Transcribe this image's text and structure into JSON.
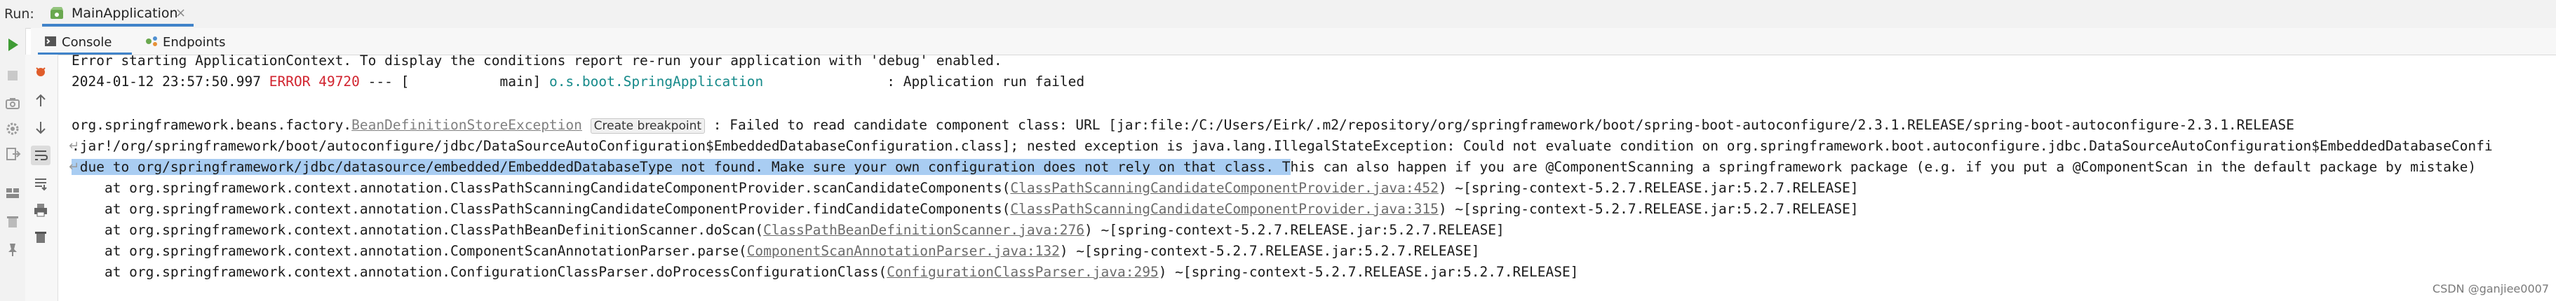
{
  "run": {
    "label": "Run:",
    "tab_title": "MainApplication",
    "close_glyph": "×"
  },
  "subtabs": {
    "console": "Console",
    "endpoints": "Endpoints"
  },
  "toolbar_icons": [
    "rerun-icon",
    "stop-icon",
    "camera-icon",
    "settings-icon",
    "exit-icon",
    "layout-icon",
    "pin-icon",
    "debug-icon",
    "up-arrow-icon",
    "down-arrow-icon",
    "soft-wrap-icon",
    "scroll-to-end-icon",
    "print-icon",
    "trash-icon"
  ],
  "console": {
    "line1": "Error starting ApplicationContext. To display the conditions report re-run your application with 'debug' enabled.",
    "line2": {
      "timestamp": "2024-01-12 23:57:50.997 ",
      "level": "ERROR",
      "pid": " 49720",
      "thread": " --- [           main] ",
      "logger": "o.s.boot.SpringApplication",
      "message": "               : Application run failed"
    },
    "line4": {
      "prefix": "org.springframework.beans.factory.",
      "exception_link": "BeanDefinitionStoreException",
      "breakpoint_button": "Create breakpoint",
      "rest": " : Failed to read candidate component class: URL [jar:file:/C:/Users/Eirk/.m2/repository/org/springframework/boot/spring-boot-autoconfigure/2.3.1.RELEASE/spring-boot-autoconfigure-2.3.1.RELEASE"
    },
    "line5": ".jar!/org/springframework/boot/autoconfigure/jdbc/DataSourceAutoConfiguration$EmbeddedDatabaseConfiguration.class]; nested exception is java.lang.IllegalStateException: Could not evaluate condition on org.springframework.boot.autoconfigure.jdbc.DataSourceAutoConfiguration$EmbeddedDatabaseConfi",
    "line6": {
      "highlighted": " due to org/springframework/jdbc/datasource/embedded/EmbeddedDatabaseType not found. Make sure your own configuration does not rely on that class. T",
      "rest": "his can also happen if you are @ComponentScanning a springframework package (e.g. if you put a @ComponentScan in the default package by mistake)"
    },
    "frames": [
      {
        "at": "    at org.springframework.context.annotation.ClassPathScanningCandidateComponentProvider.scanCandidateComponents(",
        "link": "ClassPathScanningCandidateComponentProvider.java:452",
        "tail": ") ~[spring-context-5.2.7.RELEASE.jar:5.2.7.RELEASE]"
      },
      {
        "at": "    at org.springframework.context.annotation.ClassPathScanningCandidateComponentProvider.findCandidateComponents(",
        "link": "ClassPathScanningCandidateComponentProvider.java:315",
        "tail": ") ~[spring-context-5.2.7.RELEASE.jar:5.2.7.RELEASE]"
      },
      {
        "at": "    at org.springframework.context.annotation.ClassPathBeanDefinitionScanner.doScan(",
        "link": "ClassPathBeanDefinitionScanner.java:276",
        "tail": ") ~[spring-context-5.2.7.RELEASE.jar:5.2.7.RELEASE]"
      },
      {
        "at": "    at org.springframework.context.annotation.ComponentScanAnnotationParser.parse(",
        "link": "ComponentScanAnnotationParser.java:132",
        "tail": ") ~[spring-context-5.2.7.RELEASE.jar:5.2.7.RELEASE]"
      },
      {
        "at": "    at org.springframework.context.annotation.ConfigurationClassParser.doProcessConfigurationClass(",
        "link": "ConfigurationClassParser.java:295",
        "tail": ") ~[spring-context-5.2.7.RELEASE.jar:5.2.7.RELEASE]"
      }
    ]
  },
  "watermark": "CSDN @ganjiee0007",
  "colors": {
    "error": "#d1242f",
    "logger": "#168a8a",
    "selection": "#a9cdf2",
    "link": "#808080",
    "tab_accent": "#4083c9"
  }
}
